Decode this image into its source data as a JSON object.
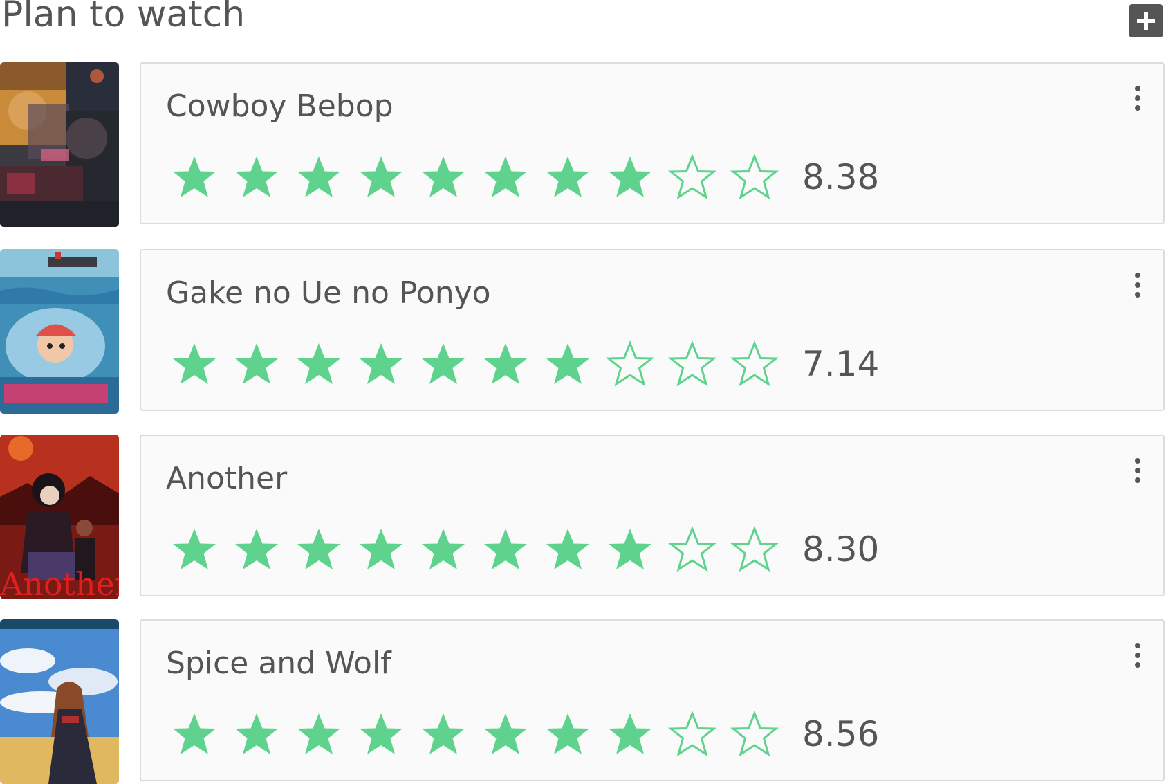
{
  "header": {
    "title": "Plan to watch",
    "add_icon": "plus-icon"
  },
  "colors": {
    "star": "#5fd38d",
    "text": "#555555",
    "card_border": "#dcdcdc"
  },
  "rating_scale_max": 10,
  "entries": [
    {
      "title": "Cowboy Bebop",
      "score": "8.38",
      "stars_filled": 8,
      "poster_icon": "cowboy-bebop-poster"
    },
    {
      "title": "Gake no Ue no Ponyo",
      "score": "7.14",
      "stars_filled": 7,
      "poster_icon": "ponyo-poster"
    },
    {
      "title": "Another",
      "score": "8.30",
      "stars_filled": 8,
      "poster_icon": "another-poster",
      "poster_text": "Another"
    },
    {
      "title": "Spice and Wolf",
      "score": "8.56",
      "stars_filled": 8,
      "poster_icon": "spice-and-wolf-poster"
    }
  ]
}
